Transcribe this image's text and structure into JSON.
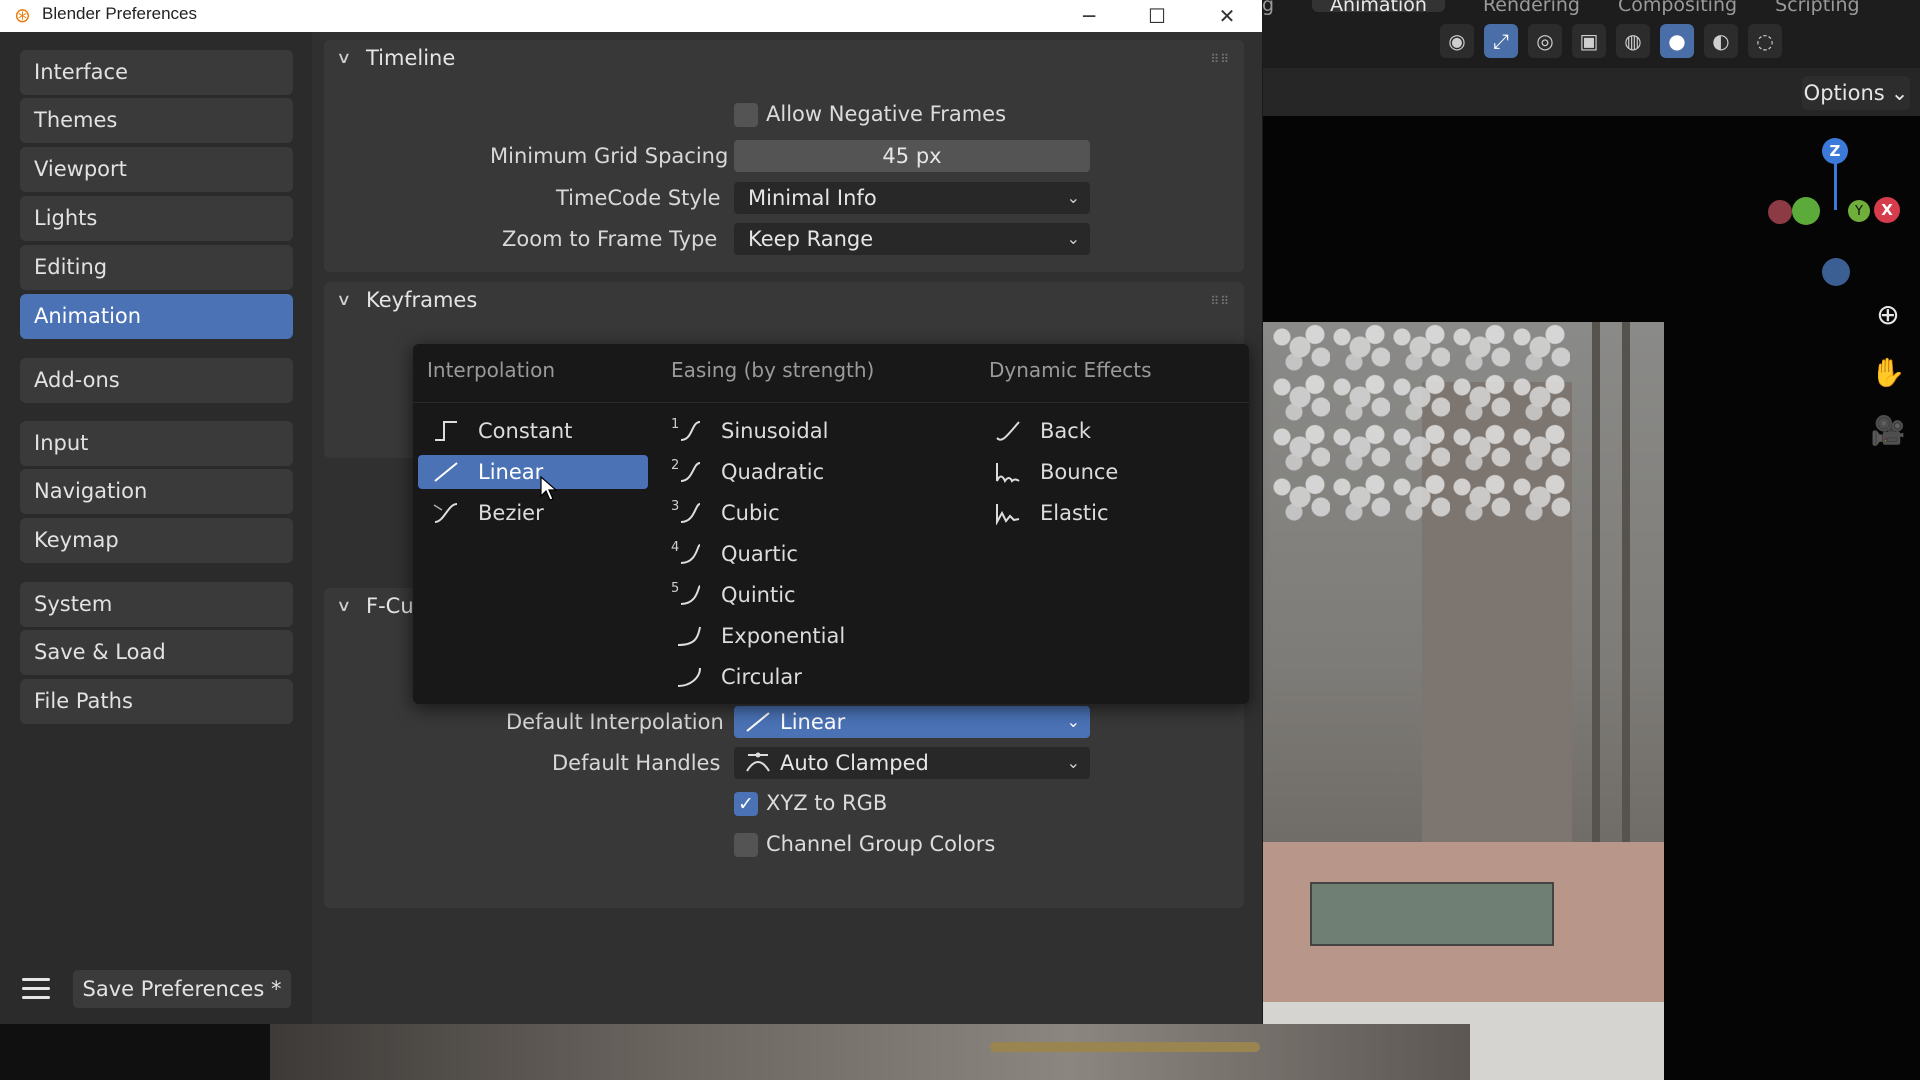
{
  "window": {
    "title": "Blender Preferences",
    "controls": [
      "─",
      "☐",
      "✕"
    ]
  },
  "background": {
    "tabs": [
      "g",
      "Animation",
      "Rendering",
      "Compositing",
      "Scripting"
    ],
    "options_label": "Options",
    "gizmo": {
      "z": "Z",
      "x": "X",
      "y": "Y"
    }
  },
  "sidebar": {
    "items": [
      {
        "label": "Interface"
      },
      {
        "label": "Themes"
      },
      {
        "label": "Viewport"
      },
      {
        "label": "Lights"
      },
      {
        "label": "Editing"
      },
      {
        "label": "Animation",
        "active": true
      },
      {
        "label": "Add-ons"
      },
      {
        "label": "Input"
      },
      {
        "label": "Navigation"
      },
      {
        "label": "Keymap"
      },
      {
        "label": "System"
      },
      {
        "label": "Save & Load"
      },
      {
        "label": "File Paths"
      }
    ],
    "save_label": "Save Preferences *"
  },
  "timeline": {
    "title": "Timeline",
    "allow_negative_frames": {
      "label": "Allow Negative Frames",
      "checked": false
    },
    "min_grid_spacing": {
      "label": "Minimum Grid Spacing",
      "value": "45 px"
    },
    "timecode_style": {
      "label": "TimeCode Style",
      "value": "Minimal Info"
    },
    "zoom_to_frame": {
      "label": "Zoom to Frame Type",
      "value": "Keep Range"
    }
  },
  "keyframes": {
    "title": "Keyframes"
  },
  "fcurves": {
    "title_partial": "F-Cu",
    "default_interpolation": {
      "label": "Default Interpolation",
      "value": "Linear"
    },
    "default_handles": {
      "label": "Default Handles",
      "value": "Auto Clamped"
    },
    "xyz_to_rgb": {
      "label": "XYZ to RGB",
      "checked": true
    },
    "channel_group_colors": {
      "label": "Channel Group Colors",
      "checked": false
    }
  },
  "popup": {
    "columns": {
      "interpolation": {
        "title": "Interpolation",
        "items": [
          {
            "label": "Constant",
            "icon": "constant-icon"
          },
          {
            "label": "Linear",
            "icon": "linear-icon",
            "selected": true
          },
          {
            "label": "Bezier",
            "icon": "bezier-icon"
          }
        ]
      },
      "easing": {
        "title": "Easing (by strength)",
        "items": [
          {
            "label": "Sinusoidal",
            "num": "1"
          },
          {
            "label": "Quadratic",
            "num": "2"
          },
          {
            "label": "Cubic",
            "num": "3"
          },
          {
            "label": "Quartic",
            "num": "4"
          },
          {
            "label": "Quintic",
            "num": "5"
          },
          {
            "label": "Exponential",
            "num": ""
          },
          {
            "label": "Circular",
            "num": ""
          }
        ]
      },
      "dynamic": {
        "title": "Dynamic Effects",
        "items": [
          {
            "label": "Back"
          },
          {
            "label": "Bounce"
          },
          {
            "label": "Elastic"
          }
        ]
      }
    }
  },
  "colors": {
    "accent": "#4a72b5",
    "panel": "#383838",
    "window": "#303030",
    "popup": "#181818"
  }
}
